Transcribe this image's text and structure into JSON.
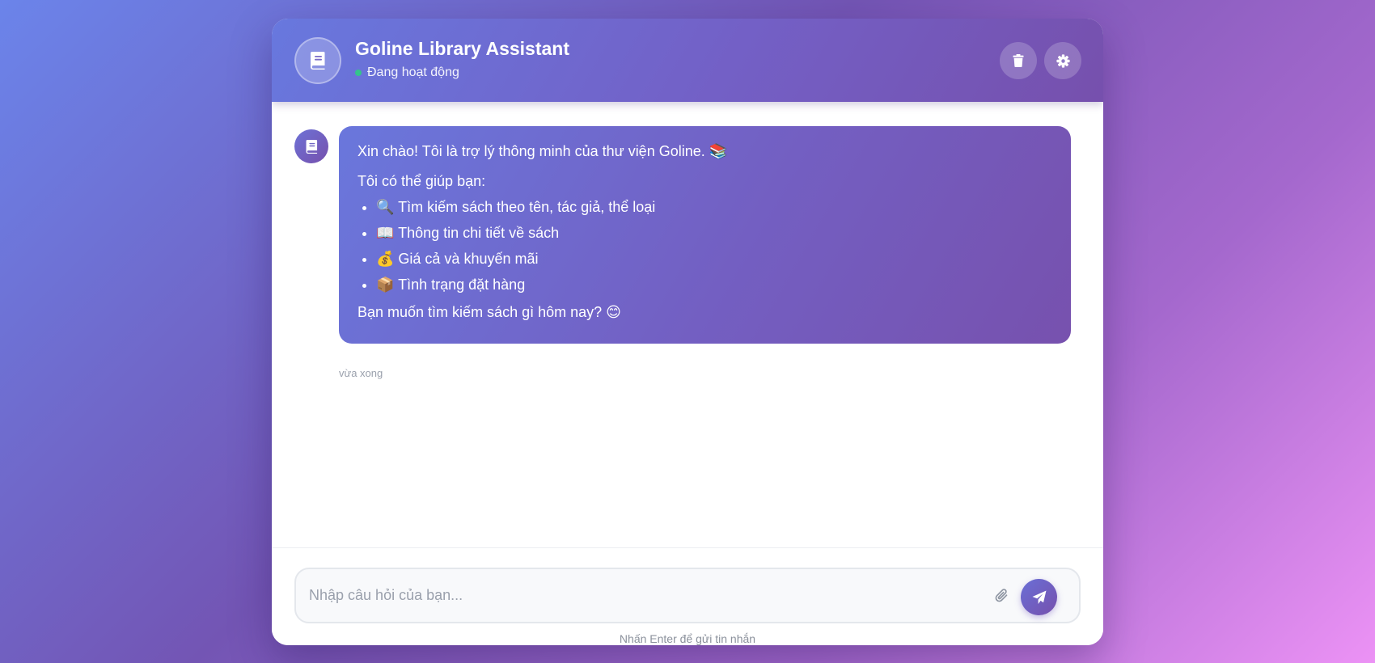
{
  "header": {
    "title": "Goline Library Assistant",
    "status": "Đang hoạt động",
    "avatar_icon": "book-icon",
    "buttons": {
      "delete_icon": "trash-icon",
      "settings_icon": "gear-icon"
    }
  },
  "messages": [
    {
      "sender": "bot",
      "avatar_icon": "book-icon",
      "intro": "Xin chào! Tôi là trợ lý thông minh của thư viện Goline. 📚",
      "subheading": "Tôi có thể giúp bạn:",
      "items": [
        "🔍 Tìm kiếm sách theo tên, tác giả, thể loại",
        "📖 Thông tin chi tiết về sách",
        "💰 Giá cả và khuyến mãi",
        "📦 Tình trạng đặt hàng"
      ],
      "closing": "Bạn muốn tìm kiếm sách gì hôm nay? 😊",
      "time": "vừa xong"
    }
  ],
  "composer": {
    "placeholder": "Nhập câu hỏi của bạn...",
    "value": "",
    "attach_icon": "paperclip-icon",
    "send_icon": "paper-plane-icon",
    "hint": "Nhấn Enter để gửi tin nhắn"
  },
  "colors": {
    "accent_start": "#6a77dc",
    "accent_end": "#7751ae",
    "status_online": "#34c48b"
  }
}
